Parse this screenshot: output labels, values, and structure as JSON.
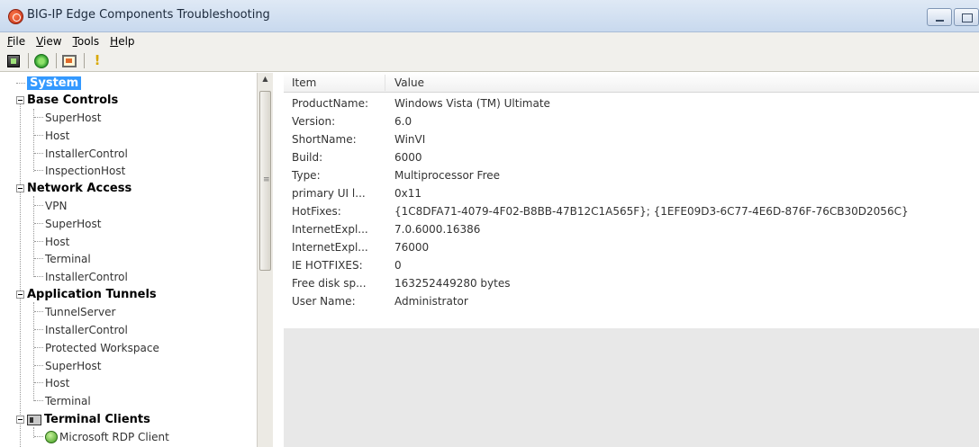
{
  "window": {
    "title": "BIG-IP Edge Components Troubleshooting"
  },
  "menu": [
    {
      "label": "File",
      "key": "F",
      "rest": "ile"
    },
    {
      "label": "View",
      "key": "V",
      "rest": "iew"
    },
    {
      "label": "Tools",
      "key": "T",
      "rest": "ools"
    },
    {
      "label": "Help",
      "key": "H",
      "rest": "elp"
    }
  ],
  "toolbar": {
    "icons": [
      "save-report-icon",
      "refresh-icon",
      "screenshot-icon",
      "warning-icon"
    ],
    "warning_glyph": "!"
  },
  "tree": {
    "selected": "System",
    "groups": [
      {
        "label": "System"
      },
      {
        "label": "Base Controls",
        "items": [
          "SuperHost",
          "Host",
          "InstallerControl",
          "InspectionHost"
        ]
      },
      {
        "label": "Network Access",
        "items": [
          "VPN",
          "SuperHost",
          "Host",
          "Terminal",
          "InstallerControl"
        ]
      },
      {
        "label": "Application Tunnels",
        "items": [
          "TunnelServer",
          "InstallerControl",
          "Protected Workspace",
          "SuperHost",
          "Host",
          "Terminal"
        ]
      },
      {
        "label": "Terminal Clients",
        "items": [
          "Microsoft RDP Client"
        ]
      }
    ]
  },
  "list": {
    "columns": [
      "Item",
      "Value"
    ],
    "rows": [
      [
        "ProductName:",
        "Windows Vista (TM) Ultimate"
      ],
      [
        "Version:",
        "6.0"
      ],
      [
        "ShortName:",
        "WinVI"
      ],
      [
        "Build:",
        "6000"
      ],
      [
        "Type:",
        "Multiprocessor Free"
      ],
      [
        "primary UI l...",
        "0x11"
      ],
      [
        "HotFixes:",
        "{1C8DFA71-4079-4F02-B8BB-47B12C1A565F}; {1EFE09D3-6C77-4E6D-876F-76CB30D2056C}"
      ],
      [
        "InternetExpl...",
        "7.0.6000.16386"
      ],
      [
        "InternetExpl...",
        "76000"
      ],
      [
        "IE HOTFIXES:",
        "0"
      ],
      [
        "Free disk sp...",
        "163252449280  bytes"
      ],
      [
        "User Name:",
        "Administrator"
      ]
    ]
  },
  "colors": {
    "selection": "#3399ff",
    "titlebar": "#c8d9ee"
  }
}
